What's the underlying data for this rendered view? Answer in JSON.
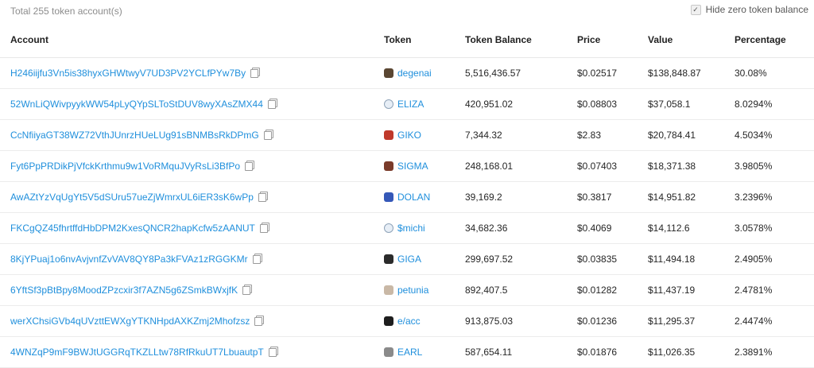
{
  "header": {
    "total_text": "Total 255 token account(s)",
    "hide_zero_label": "Hide zero token balance",
    "hide_zero_checked": true
  },
  "columns": {
    "account": "Account",
    "token": "Token",
    "balance": "Token Balance",
    "price": "Price",
    "value": "Value",
    "percentage": "Percentage"
  },
  "rows": [
    {
      "account": "H246iijfu3Vn5is38hyxGHWtwyV7UD3PV2YCLfPYw7By",
      "token": "degenai",
      "icon": "degenai-icon",
      "icon_color": "#5a4632",
      "balance": "5,516,436.57",
      "price": "$0.02517",
      "value": "$138,848.87",
      "percentage": "30.08%"
    },
    {
      "account": "52WnLiQWivpyykWW54pLyQYpSLToStDUV8wyXAsZMX44",
      "token": "ELIZA",
      "icon": "eliza-icon",
      "icon_color": "#e7eef6",
      "balance": "420,951.02",
      "price": "$0.08803",
      "value": "$37,058.1",
      "percentage": "8.0294%"
    },
    {
      "account": "CcNfiiyaGT38WZ72VthJUnrzHUeLUg91sBNMBsRkDPmG",
      "token": "GIKO",
      "icon": "giko-icon",
      "icon_color": "#c0392b",
      "balance": "7,344.32",
      "price": "$2.83",
      "value": "$20,784.41",
      "percentage": "4.5034%"
    },
    {
      "account": "Fyt6PpPRDikPjVfckKrthmu9w1VoRMquJVyRsLi3BfPo",
      "token": "SIGMA",
      "icon": "sigma-icon",
      "icon_color": "#7a3b2a",
      "balance": "248,168.01",
      "price": "$0.07403",
      "value": "$18,371.38",
      "percentage": "3.9805%"
    },
    {
      "account": "AwAZtYzVqUgYt5V5dSUru57ueZjWmrxUL6iER3sK6wPp",
      "token": "DOLAN",
      "icon": "dolan-icon",
      "icon_color": "#3558b8",
      "balance": "39,169.2",
      "price": "$0.3817",
      "value": "$14,951.82",
      "percentage": "3.2396%"
    },
    {
      "account": "FKCgQZ45fhrtffdHbDPM2KxesQNCR2hapKcfw5zAANUT",
      "token": "$michi",
      "icon": "michi-icon",
      "icon_color": "#e7eef6",
      "balance": "34,682.36",
      "price": "$0.4069",
      "value": "$14,112.6",
      "percentage": "3.0578%"
    },
    {
      "account": "8KjYPuaj1o6nvAvjvnfZvVAV8QY8Pa3kFVAz1zRGGKMr",
      "token": "GIGA",
      "icon": "giga-icon",
      "icon_color": "#2b2b2b",
      "balance": "299,697.52",
      "price": "$0.03835",
      "value": "$11,494.18",
      "percentage": "2.4905%"
    },
    {
      "account": "6YftSf3pBtBpy8MoodZPzcxir3f7AZN5g6ZSmkBWxjfK",
      "token": "petunia",
      "icon": "petunia-icon",
      "icon_color": "#c9b8a6",
      "balance": "892,407.5",
      "price": "$0.01282",
      "value": "$11,437.19",
      "percentage": "2.4781%"
    },
    {
      "account": "werXChsiGVb4qUVzttEWXgYTKNHpdAXKZmj2Mhofzsz",
      "token": "e/acc",
      "icon": "eacc-icon",
      "icon_color": "#1e1e1e",
      "balance": "913,875.03",
      "price": "$0.01236",
      "value": "$11,295.37",
      "percentage": "2.4474%"
    },
    {
      "account": "4WNZqP9mF9BWJtUGGRqTKZLLtw78RfRkuUT7LbuautpT",
      "token": "EARL",
      "icon": "earl-icon",
      "icon_color": "#8a8a8a",
      "balance": "587,654.11",
      "price": "$0.01876",
      "value": "$11,026.35",
      "percentage": "2.3891%"
    }
  ]
}
